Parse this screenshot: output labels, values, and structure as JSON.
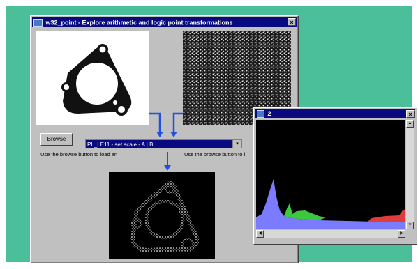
{
  "main_window": {
    "title": "w32_point - Explore arithmetic and logic point transformations",
    "close_label": "×"
  },
  "controls": {
    "browse_label": "Browse",
    "transform_select_value": "PL_LE11 - set scale - A | B",
    "drop_arrow": "▾",
    "hint_left": "Use the browse button to load an",
    "hint_right": "Use the browse button to l"
  },
  "histogram_window": {
    "title": "2",
    "close_label": "×"
  },
  "icons": [
    "window-app-icon",
    "close-icon",
    "dropdown-arrow-icon",
    "arrow-down-icon",
    "scroll-arrow-icon"
  ],
  "colors": {
    "desktop": "#4bbf9a",
    "titlebar": "#0a0a80",
    "histogram_blue": "#7b7bff",
    "histogram_green": "#3cc83c",
    "histogram_red": "#e03c3c"
  }
}
